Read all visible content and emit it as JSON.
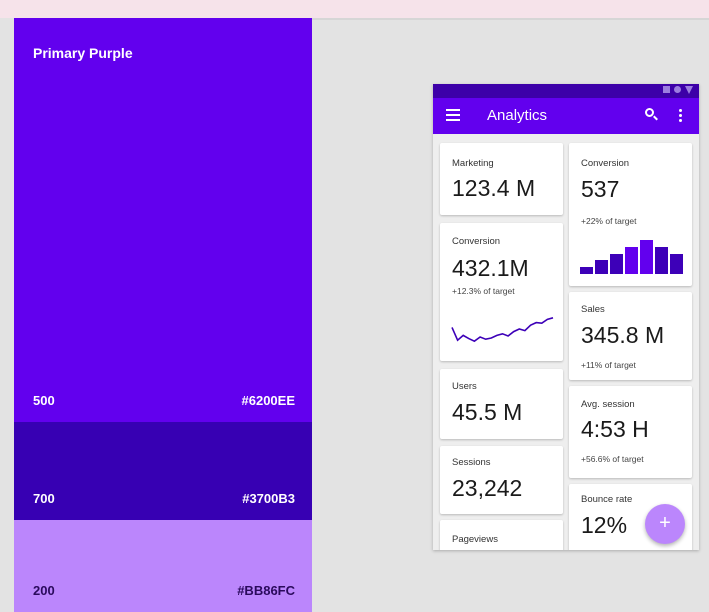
{
  "palette": {
    "name": "Primary Purple",
    "swatches": [
      {
        "level": "500",
        "hex": "#6200EE",
        "color": "#6200ee"
      },
      {
        "level": "700",
        "hex": "#3700B3",
        "color": "#3700b3"
      },
      {
        "level": "200",
        "hex": "#BB86FC",
        "color": "#bb86fc"
      }
    ]
  },
  "appbar": {
    "title": "Analytics",
    "menu_icon": "menu-icon",
    "search_icon": "search-icon",
    "more_icon": "more-vert-icon"
  },
  "status_icons": [
    "square-icon",
    "circle-icon",
    "triangle-icon"
  ],
  "cards": {
    "marketing": {
      "label": "Marketing",
      "value": "123.4 M"
    },
    "conversion_left": {
      "label": "Conversion",
      "value": "432.1M",
      "sub": "+12.3% of target",
      "sparkline": [
        0.55,
        0.15,
        0.3,
        0.2,
        0.12,
        0.25,
        0.18,
        0.22,
        0.3,
        0.35,
        0.28,
        0.42,
        0.5,
        0.45,
        0.62,
        0.7,
        0.68,
        0.8,
        0.85
      ]
    },
    "conversion_right": {
      "label": "Conversion",
      "value": "537",
      "sub": "+22% of target",
      "bars": [
        2,
        4,
        6,
        8,
        10,
        8,
        6
      ]
    },
    "sales": {
      "label": "Sales",
      "value": "345.8 M",
      "sub": "+11% of target"
    },
    "users": {
      "label": "Users",
      "value": "45.5 M"
    },
    "avg_session": {
      "label": "Avg. session",
      "value": "4:53 H",
      "sub": "+56.6% of target"
    },
    "sessions": {
      "label": "Sessions",
      "value": "23,242"
    },
    "bounce": {
      "label": "Bounce rate",
      "value": "12%"
    },
    "pageviews": {
      "label": "Pageviews"
    }
  },
  "fab": {
    "label": "+",
    "icon": "add-icon"
  },
  "colors": {
    "primary": "#6200ee",
    "primary_dark": "#3700b3",
    "accent": "#bb86fc"
  }
}
